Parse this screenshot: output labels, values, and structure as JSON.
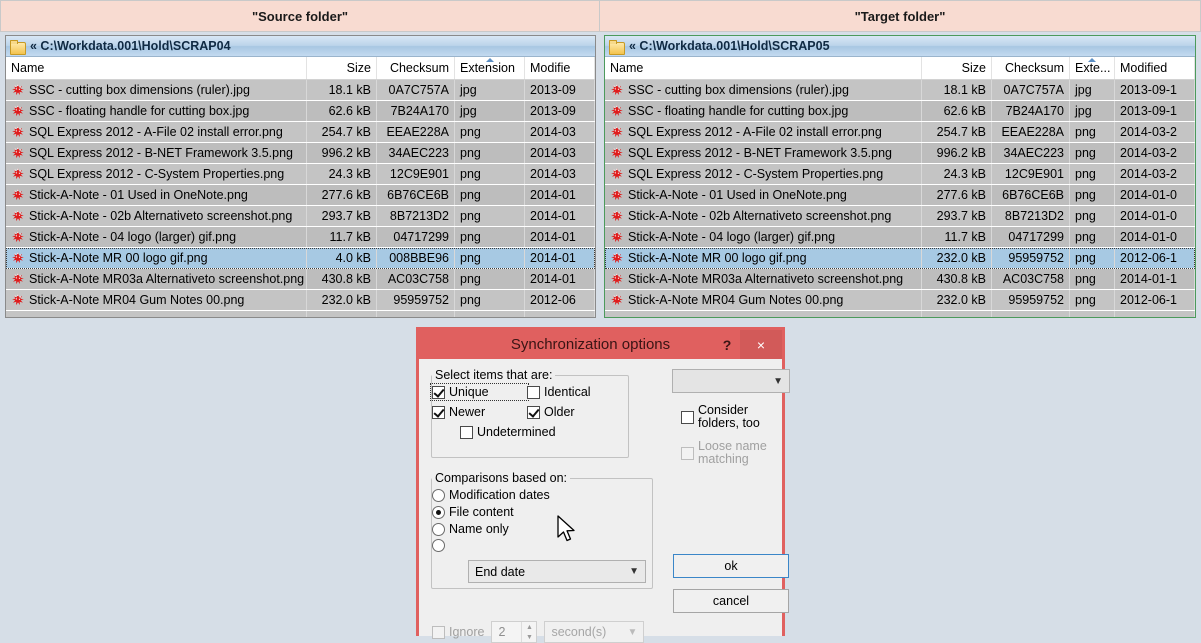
{
  "panels": [
    {
      "banner": "\"Source folder\"",
      "path": "« C:\\Workdata.001\\Hold\\SCRAP04",
      "columns": [
        "Name",
        "Size",
        "Checksum",
        "Extension",
        "Modifie"
      ],
      "rows": [
        {
          "name": "SSC - cutting box dimensions (ruler).jpg",
          "size": "18.1 kB",
          "checksum": "0A7C757A",
          "ext": "jpg",
          "modified": "2013-09"
        },
        {
          "name": "SSC - floating handle for cutting box.jpg",
          "size": "62.6 kB",
          "checksum": "7B24A170",
          "ext": "jpg",
          "modified": "2013-09"
        },
        {
          "name": "SQL Express 2012 - A-File 02 install error.png",
          "size": "254.7 kB",
          "checksum": "EEAE228A",
          "ext": "png",
          "modified": "2014-03"
        },
        {
          "name": "SQL Express 2012 - B-NET Framework 3.5.png",
          "size": "996.2 kB",
          "checksum": "34AEC223",
          "ext": "png",
          "modified": "2014-03"
        },
        {
          "name": "SQL Express 2012 - C-System Properties.png",
          "size": "24.3 kB",
          "checksum": "12C9E901",
          "ext": "png",
          "modified": "2014-03"
        },
        {
          "name": "Stick-A-Note - 01 Used in OneNote.png",
          "size": "277.6 kB",
          "checksum": "6B76CE6B",
          "ext": "png",
          "modified": "2014-01"
        },
        {
          "name": "Stick-A-Note - 02b Alternativeto screenshot.png",
          "size": "293.7 kB",
          "checksum": "8B7213D2",
          "ext": "png",
          "modified": "2014-01"
        },
        {
          "name": "Stick-A-Note - 04 logo (larger) gif.png",
          "size": "11.7 kB",
          "checksum": "04717299",
          "ext": "png",
          "modified": "2014-01"
        },
        {
          "name": "Stick-A-Note MR 00 logo gif.png",
          "size": "4.0 kB",
          "checksum": "008BBE96",
          "ext": "png",
          "modified": "2014-01",
          "selected": true
        },
        {
          "name": "Stick-A-Note MR03a  Alternativeto screenshot.png",
          "size": "430.8 kB",
          "checksum": "AC03C758",
          "ext": "png",
          "modified": "2014-01"
        },
        {
          "name": "Stick-A-Note MR04 Gum Notes 00.png",
          "size": "232.0 kB",
          "checksum": "95959752",
          "ext": "png",
          "modified": "2012-06"
        }
      ]
    },
    {
      "banner": "\"Target folder\"",
      "path": "« C:\\Workdata.001\\Hold\\SCRAP05",
      "columns": [
        "Name",
        "Size",
        "Checksum",
        "Exte...",
        "Modified"
      ],
      "rows": [
        {
          "name": "SSC - cutting box dimensions (ruler).jpg",
          "size": "18.1 kB",
          "checksum": "0A7C757A",
          "ext": "jpg",
          "modified": "2013-09-1"
        },
        {
          "name": "SSC - floating handle for cutting box.jpg",
          "size": "62.6 kB",
          "checksum": "7B24A170",
          "ext": "jpg",
          "modified": "2013-09-1"
        },
        {
          "name": "SQL Express 2012 - A-File 02 install error.png",
          "size": "254.7 kB",
          "checksum": "EEAE228A",
          "ext": "png",
          "modified": "2014-03-2"
        },
        {
          "name": "SQL Express 2012 - B-NET Framework 3.5.png",
          "size": "996.2 kB",
          "checksum": "34AEC223",
          "ext": "png",
          "modified": "2014-03-2"
        },
        {
          "name": "SQL Express 2012 - C-System Properties.png",
          "size": "24.3 kB",
          "checksum": "12C9E901",
          "ext": "png",
          "modified": "2014-03-2"
        },
        {
          "name": "Stick-A-Note - 01 Used in OneNote.png",
          "size": "277.6 kB",
          "checksum": "6B76CE6B",
          "ext": "png",
          "modified": "2014-01-0"
        },
        {
          "name": "Stick-A-Note - 02b Alternativeto screenshot.png",
          "size": "293.7 kB",
          "checksum": "8B7213D2",
          "ext": "png",
          "modified": "2014-01-0"
        },
        {
          "name": "Stick-A-Note - 04 logo (larger) gif.png",
          "size": "11.7 kB",
          "checksum": "04717299",
          "ext": "png",
          "modified": "2014-01-0"
        },
        {
          "name": "Stick-A-Note MR 00 logo gif.png",
          "size": "232.0 kB",
          "checksum": "95959752",
          "ext": "png",
          "modified": "2012-06-1",
          "selected": true
        },
        {
          "name": "Stick-A-Note MR03a  Alternativeto screenshot.png",
          "size": "430.8 kB",
          "checksum": "AC03C758",
          "ext": "png",
          "modified": "2014-01-1"
        },
        {
          "name": "Stick-A-Note MR04 Gum Notes 00.png",
          "size": "232.0 kB",
          "checksum": "95959752",
          "ext": "png",
          "modified": "2012-06-1"
        }
      ]
    }
  ],
  "dialog": {
    "title": "Synchronization options",
    "help_label": "?",
    "close_label": "×",
    "select_group": {
      "legend": "Select items that are:",
      "unique": "Unique",
      "identical": "Identical",
      "newer": "Newer",
      "older": "Older",
      "undetermined": "Undetermined"
    },
    "compare_group": {
      "legend": "Comparisons based on:",
      "modification_dates": "Modification dates",
      "file_content": "File content",
      "name_only": "Name only",
      "end_date": "End date"
    },
    "top_combo_value": "",
    "consider_folders": "Consider folders, too",
    "loose_name_matching": "Loose name matching",
    "ok": "ok",
    "cancel": "cancel",
    "ignore": "Ignore",
    "ignore_value": "2",
    "ignore_unit": "second(s)"
  },
  "colors": {
    "banner": "#f8dbd1",
    "dialog_accent": "#e0605f",
    "selection": "#a7c9e3",
    "target_border": "#4c9a5c"
  }
}
